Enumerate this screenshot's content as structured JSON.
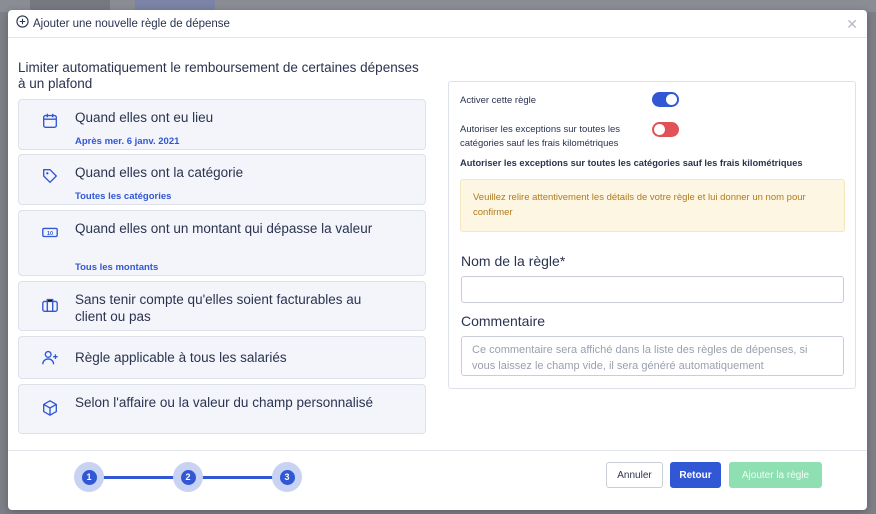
{
  "modal": {
    "title": "Ajouter une nouvelle règle de dépense"
  },
  "left": {
    "heading": "Limiter automatiquement le remboursement de certaines dépenses à un plafond",
    "criteria": [
      {
        "icon": "calendar-icon",
        "label": "Quand elles ont eu lieu",
        "sub": "Après mer. 6 janv. 2021"
      },
      {
        "icon": "tag-icon",
        "label": "Quand elles ont la catégorie",
        "sub": "Toutes les catégories"
      },
      {
        "icon": "banknote-icon",
        "label": "Quand elles ont un montant qui dépasse la valeur",
        "sub": "Tous les montants"
      },
      {
        "icon": "briefcase-icon",
        "label": "Sans tenir compte qu'elles soient facturables au client ou pas",
        "sub": ""
      },
      {
        "icon": "user-plus-icon",
        "label": "Règle applicable à tous les salariés",
        "sub": ""
      },
      {
        "icon": "cube-icon",
        "label": "Selon l'affaire ou la valeur du champ personnalisé",
        "sub": ""
      }
    ]
  },
  "right": {
    "activate_label": "Activer cette règle",
    "activate_on": true,
    "exceptions_label": "Autoriser les exceptions sur toutes les catégories sauf les frais kilométriques",
    "exceptions_on": false,
    "exceptions_note": "Autoriser les exceptions sur toutes les catégories sauf les frais kilométriques",
    "warning": "Veuillez relire attentivement les détails de votre règle et lui donner un nom pour confirmer",
    "name_label": "Nom de la règle*",
    "name_value": "",
    "comment_label": "Commentaire",
    "comment_placeholder": "Ce commentaire sera affiché dans la liste des règles de dépenses, si vous laissez le champ vide, il sera généré automatiquement"
  },
  "steps": [
    "1",
    "2",
    "3"
  ],
  "footer": {
    "cancel": "Annuler",
    "back": "Retour",
    "add": "Ajouter la règle"
  },
  "colors": {
    "accent": "#3157d5",
    "toggle_off": "#e05256",
    "add_disabled": "#8ee0b3",
    "warning_text": "#b07b1c"
  }
}
